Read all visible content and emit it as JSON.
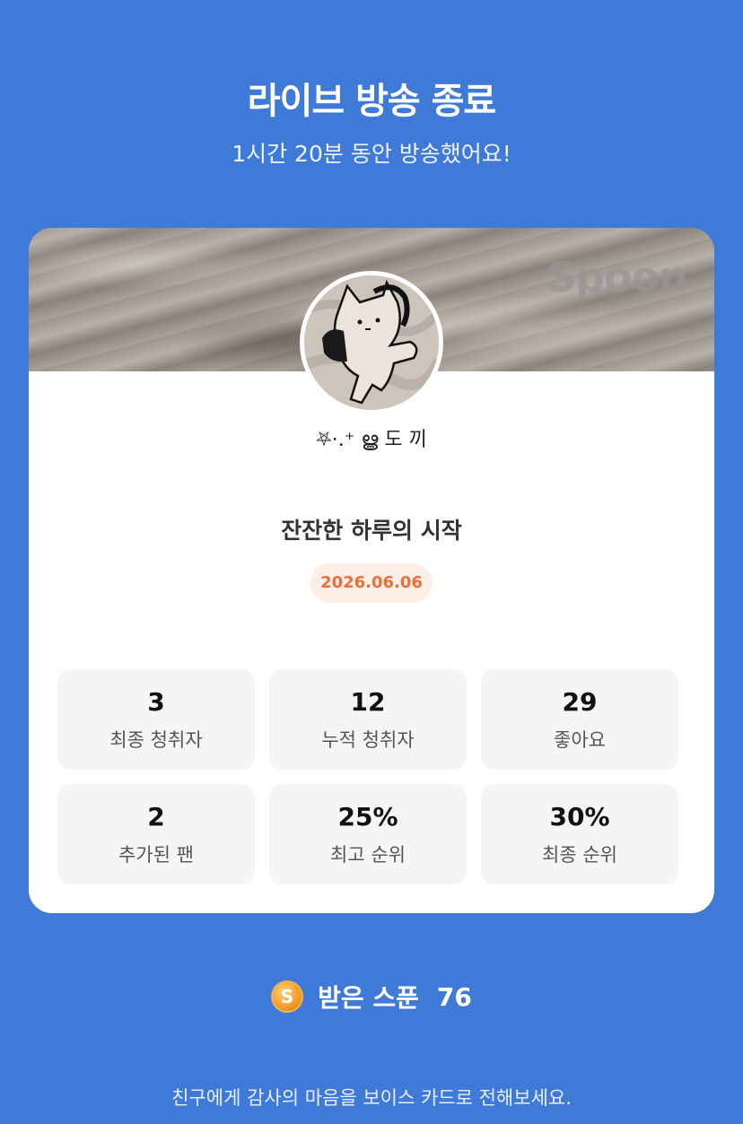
{
  "header": {
    "title": "라이브 방송 종료",
    "subtitle": "1시간 20분 동안 방송했어요!"
  },
  "card": {
    "cover_logo": "Spoon",
    "nickname": "⛧⋅.⁺ ൠ 도 끼",
    "live_title": "잔잔한 하루의 시작",
    "date": "2026.06.06",
    "stats": [
      {
        "value": "3",
        "label": "최종 청취자"
      },
      {
        "value": "12",
        "label": "누적 청취자"
      },
      {
        "value": "29",
        "label": "좋아요"
      },
      {
        "value": "2",
        "label": "추가된 팬"
      },
      {
        "value": "25%",
        "label": "최고 순위"
      },
      {
        "value": "30%",
        "label": "최종 순위"
      }
    ]
  },
  "spoons": {
    "coin_glyph": "S",
    "label": "받은 스푼",
    "count": "76"
  },
  "footer": {
    "text": "친구에게 감사의 마음을 보이스 카드로 전해보세요."
  },
  "colors": {
    "background": "#3f7ad9",
    "date_text": "#e8703c",
    "date_bg": "#fdeee6"
  }
}
